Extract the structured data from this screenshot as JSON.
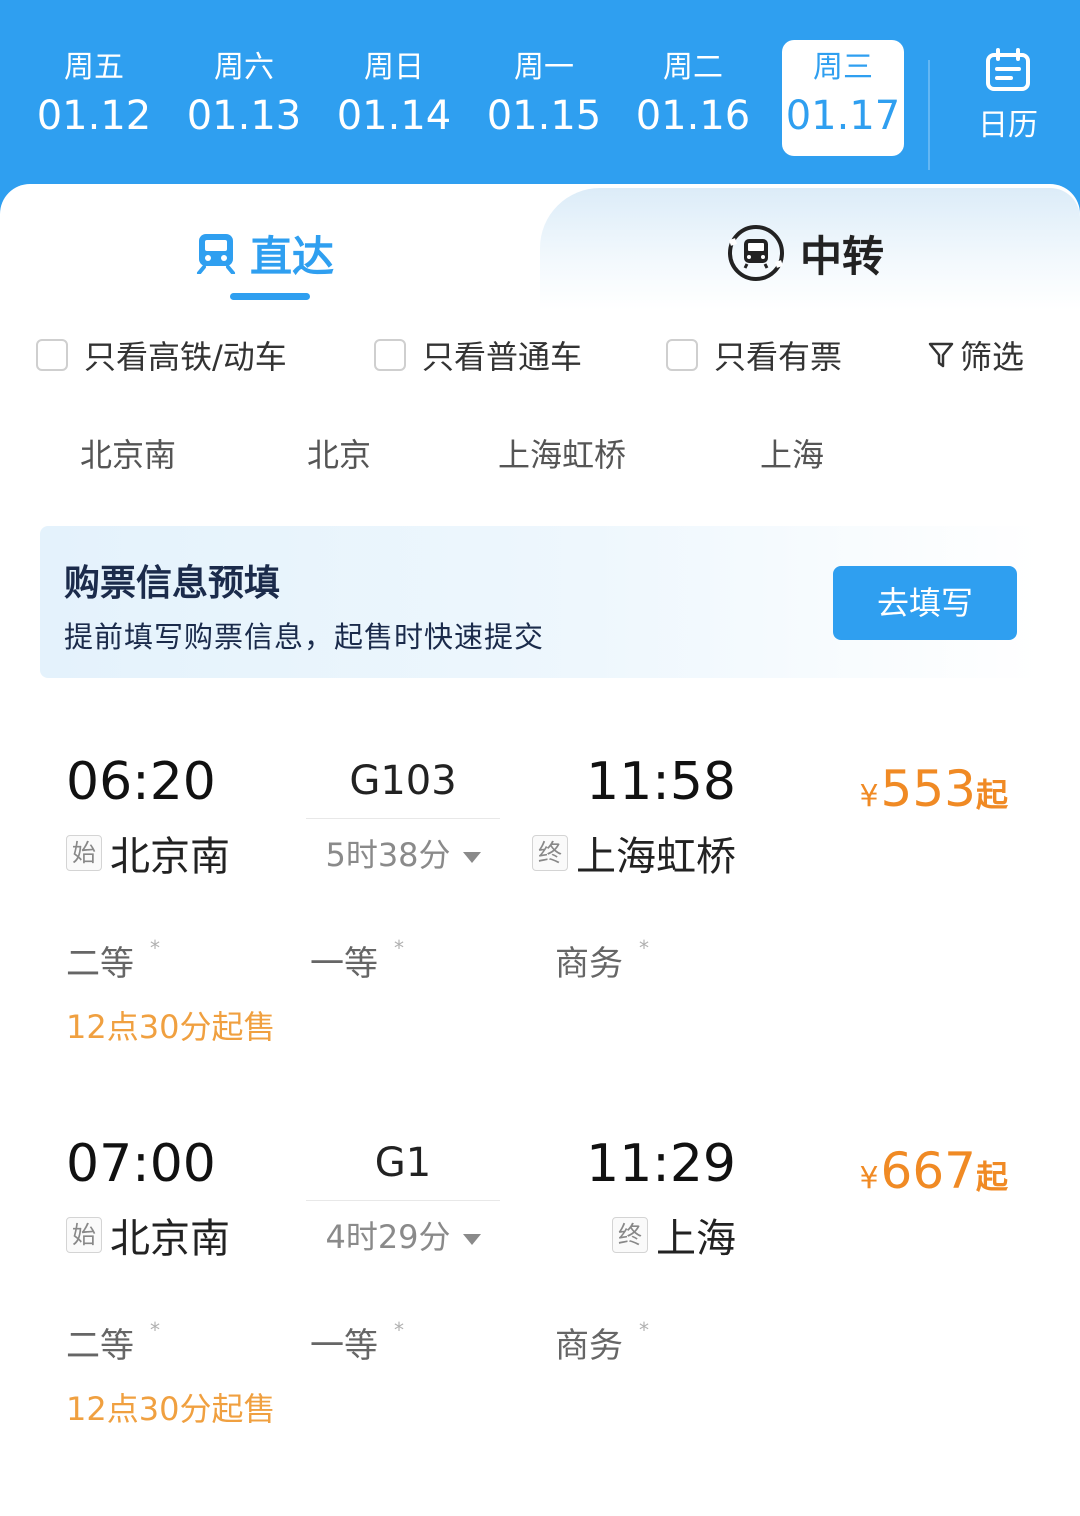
{
  "dates": [
    {
      "weekday": "周五",
      "date": "01.12",
      "selected": false
    },
    {
      "weekday": "周六",
      "date": "01.13",
      "selected": false
    },
    {
      "weekday": "周日",
      "date": "01.14",
      "selected": false
    },
    {
      "weekday": "周一",
      "date": "01.15",
      "selected": false
    },
    {
      "weekday": "周二",
      "date": "01.16",
      "selected": false
    },
    {
      "weekday": "周三",
      "date": "01.17",
      "selected": true
    }
  ],
  "calendar_label": "日历",
  "tabs": {
    "direct": "直达",
    "transfer": "中转",
    "active": "direct"
  },
  "filters": {
    "high_speed": "只看高铁/动车",
    "normal": "只看普通车",
    "available": "只看有票",
    "filter_label": "筛选"
  },
  "stations": [
    "北京南",
    "北京",
    "上海虹桥",
    "上海"
  ],
  "banner": {
    "title": "购票信息预填",
    "subtitle": "提前填写购票信息，起售时快速提交",
    "button": "去填写"
  },
  "trains": [
    {
      "departure_time": "06:20",
      "train_no": "G103",
      "arrival_time": "11:58",
      "duration": "5时38分",
      "from_tag": "始",
      "from_station": "北京南",
      "to_tag": "终",
      "to_station": "上海虹桥",
      "price_symbol": "¥",
      "price": "553",
      "price_suffix": "起",
      "seats": [
        {
          "name": "二等",
          "mark": "*"
        },
        {
          "name": "一等",
          "mark": "*"
        },
        {
          "name": "商务",
          "mark": "*"
        }
      ],
      "sale_time": "12点30分起售"
    },
    {
      "departure_time": "07:00",
      "train_no": "G1",
      "arrival_time": "11:29",
      "duration": "4时29分",
      "from_tag": "始",
      "from_station": "北京南",
      "to_tag": "终",
      "to_station": "上海",
      "price_symbol": "¥",
      "price": "667",
      "price_suffix": "起",
      "seats": [
        {
          "name": "二等",
          "mark": "*"
        },
        {
          "name": "一等",
          "mark": "*"
        },
        {
          "name": "商务",
          "mark": "*"
        }
      ],
      "sale_time": "12点30分起售"
    }
  ],
  "colors": {
    "primary": "#2f9ff0",
    "price": "#f08a24",
    "sale": "#f0a040"
  }
}
